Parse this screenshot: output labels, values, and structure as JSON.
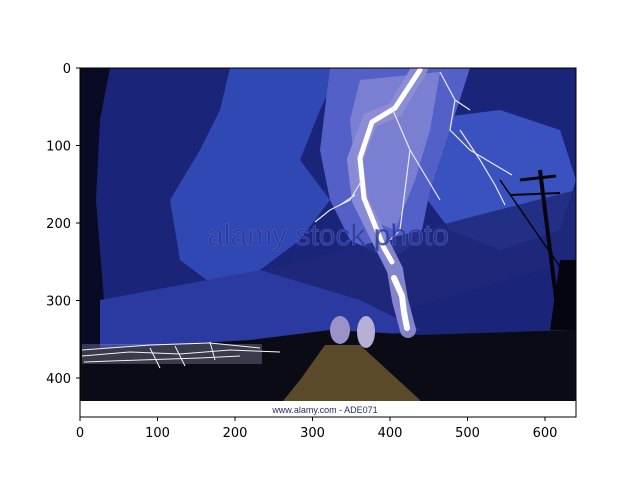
{
  "figure": {
    "x_ticks": [
      "0",
      "100",
      "200",
      "300",
      "400",
      "500",
      "600"
    ],
    "y_ticks": [
      "0",
      "100",
      "200",
      "300",
      "400"
    ]
  },
  "image": {
    "subject": "lightning-storm-night",
    "watermark": "alamy stock photo",
    "footer_text": "www.alamy.com - ADE071",
    "colors": {
      "sky_dark": "#0a0e3a",
      "sky_mid": "#1e2a8c",
      "sky_light": "#3b4fc0",
      "bolt_glow": "#8f8fd6",
      "bolt_core": "#ffffff",
      "ground": "#5a4a2a",
      "ground_dark": "#0b0b14"
    }
  }
}
